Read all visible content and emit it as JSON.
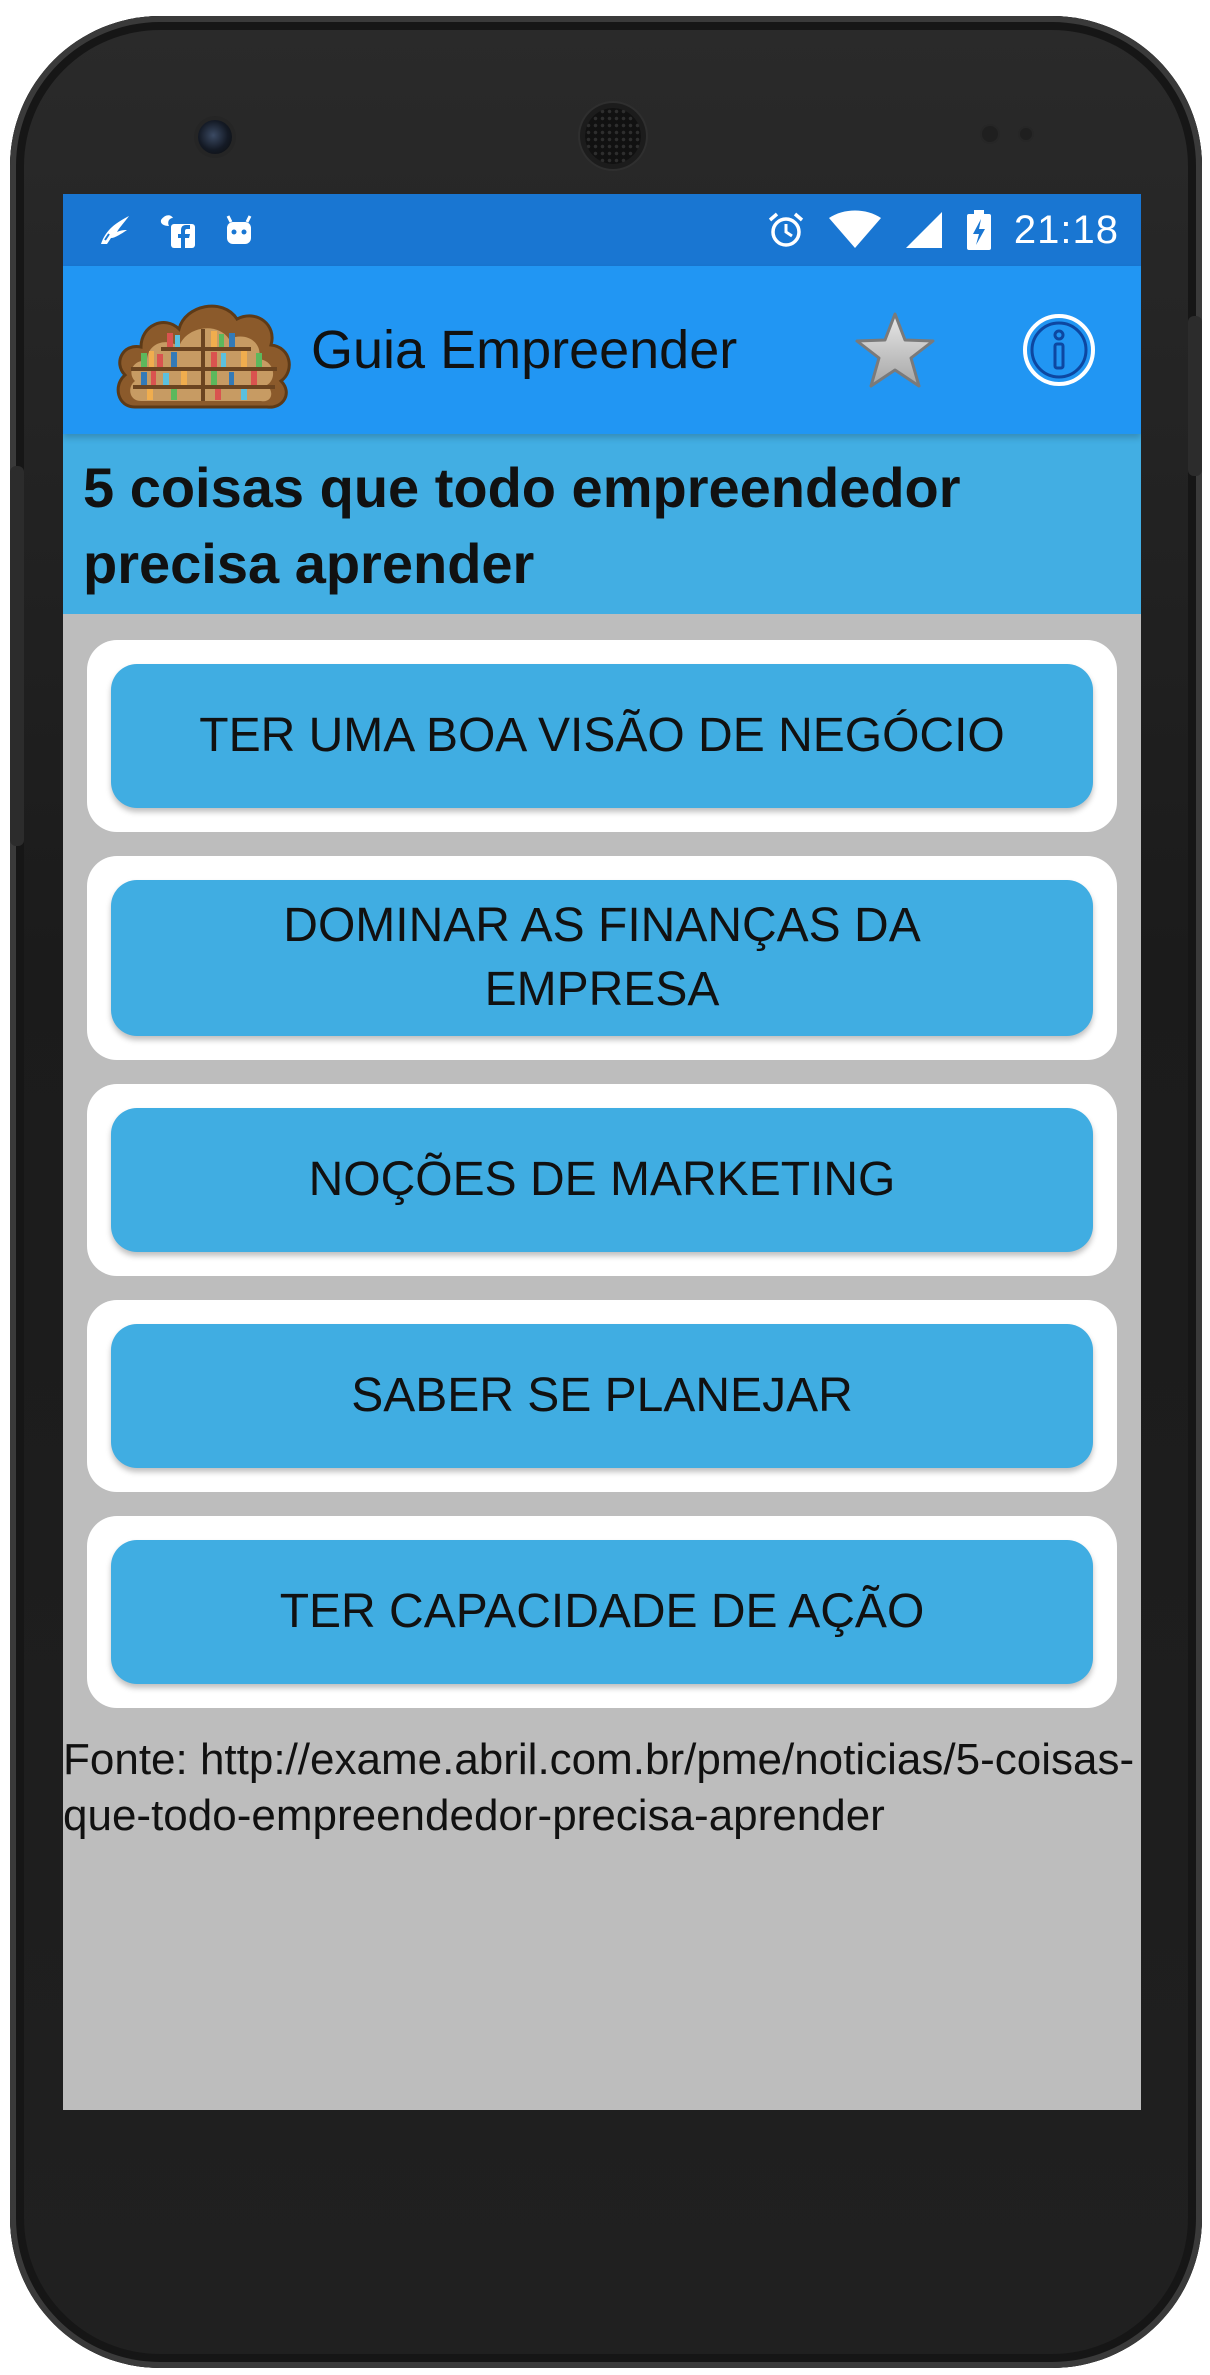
{
  "status_bar": {
    "time": "21:18",
    "left_icons": [
      "bird-notification-icon",
      "facebook-notification-icon",
      "android-notification-icon"
    ],
    "right_icons": [
      "alarm-icon",
      "wifi-icon",
      "cell-signal-icon",
      "battery-charging-icon"
    ]
  },
  "app_bar": {
    "title": "Guia Empreender",
    "logo": "bookshelf-cloud-logo",
    "actions": [
      "star-icon",
      "info-icon"
    ]
  },
  "article": {
    "heading": "5 coisas que todo empreendedor precisa aprender",
    "items": [
      "TER UMA BOA VISÃO DE NEGÓCIO",
      "DOMINAR AS FINANÇAS DA EMPRESA",
      "NOÇÕES DE MARKETING",
      "SABER SE PLANEJAR",
      "TER CAPACIDADE DE AÇÃO"
    ],
    "source": "Fonte: http://exame.abril.com.br/pme/noticias/5-coisas-que-todo-empreendedor-precisa-aprender"
  },
  "colors": {
    "status_bar": "#1976d2",
    "app_bar": "#2196f3",
    "heading_band": "#42aee3",
    "item_button": "#40ade2",
    "screen_background": "#bdbdbd"
  }
}
